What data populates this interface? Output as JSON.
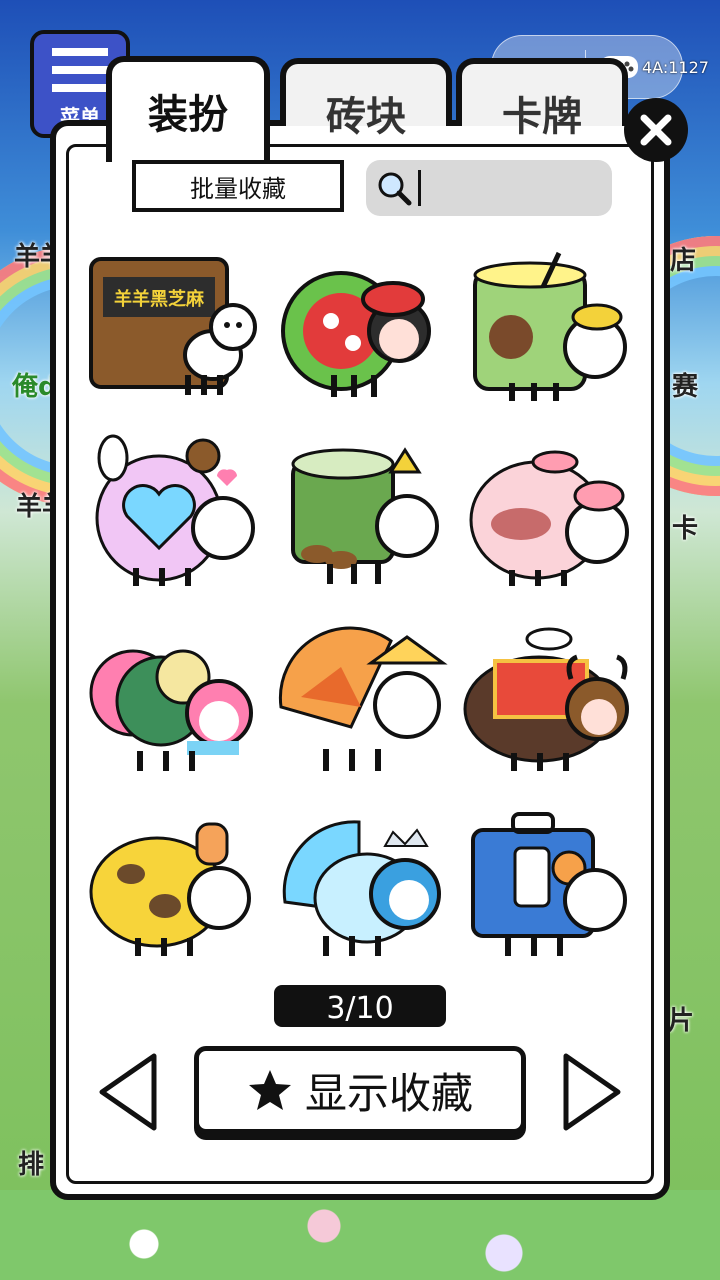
{
  "background": {
    "menu_label": "菜单",
    "side_labels": [
      "羊羊",
      "俺d",
      "羊羊",
      "店",
      "赛",
      "卡",
      "片",
      "排"
    ]
  },
  "mini_program_capsule": {
    "more_icon": "more-dots-icon",
    "game_icon": "gamepad-icon",
    "id_text": "4A:1127"
  },
  "tabs": [
    {
      "label": "装扮",
      "active": true
    },
    {
      "label": "砖块",
      "active": false
    },
    {
      "label": "卡牌",
      "active": false
    }
  ],
  "toolbar": {
    "batch_label": "批量收藏",
    "search_placeholder": "",
    "search_value": ""
  },
  "items": [
    {
      "name": "black-sesame-sheep",
      "text": "羊羊黑芝麻",
      "colors": [
        "#8b5a2b",
        "#f3d23a",
        "#2d2d2d"
      ]
    },
    {
      "name": "red-flower-girl-sheep",
      "colors": [
        "#e23b3b",
        "#6ac24b",
        "#ffffff"
      ]
    },
    {
      "name": "lemon-tea-sheep",
      "colors": [
        "#9fd37a",
        "#fff38a",
        "#7a4a2b"
      ]
    },
    {
      "name": "bunny-heart-sheep",
      "colors": [
        "#f1c6f5",
        "#7ad7ff",
        "#ff7fb0"
      ]
    },
    {
      "name": "matcha-cup-sheep",
      "colors": [
        "#6aa84f",
        "#d7ecc1",
        "#8b5a2b"
      ]
    },
    {
      "name": "pig-bowl-sheep",
      "colors": [
        "#fbd3d9",
        "#ff9db1",
        "#c76b6b"
      ]
    },
    {
      "name": "flower-hat-sheep",
      "colors": [
        "#ff7fb0",
        "#3d8f5a",
        "#7bd3f5"
      ]
    },
    {
      "name": "autumn-umbrella-sheep",
      "colors": [
        "#f6a14a",
        "#ffd35a",
        "#e86a2c"
      ]
    },
    {
      "name": "tibetan-yak-sheep",
      "colors": [
        "#5a3a2a",
        "#e84a3a",
        "#f5c242"
      ]
    },
    {
      "name": "giraffe-sheep",
      "colors": [
        "#f7d43a",
        "#8b5a2b",
        "#f5a35a"
      ]
    },
    {
      "name": "ice-princess-sheep",
      "colors": [
        "#7ad7ff",
        "#3aa0e0",
        "#c8f0ff"
      ]
    },
    {
      "name": "doraemon-box-sheep",
      "colors": [
        "#3a7bd5",
        "#ffffff",
        "#f6a14a"
      ]
    }
  ],
  "pagination": {
    "text": "3/10",
    "current": 3,
    "total": 10
  },
  "favorites_button": {
    "label": "显示收藏",
    "icon": "star-icon"
  },
  "nav": {
    "prev_icon": "triangle-left-icon",
    "next_icon": "triangle-right-icon"
  },
  "close_icon": "close-icon"
}
